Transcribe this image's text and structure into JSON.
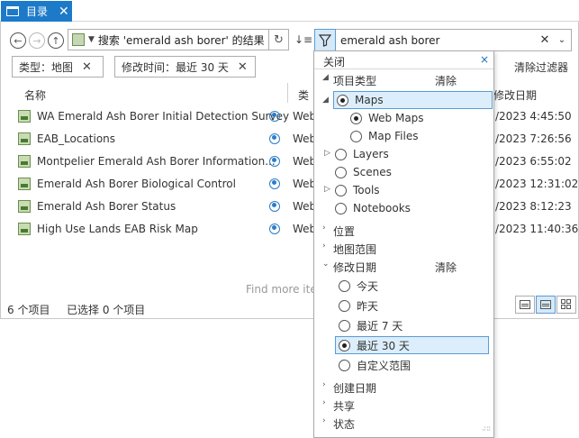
{
  "tab": {
    "label": "目录",
    "close": "✕"
  },
  "nav": {
    "path": "搜索 'emerald ash borer' 的结果",
    "search_value": "emerald ash borer"
  },
  "chips": [
    {
      "label": "类型：地图"
    },
    {
      "label": "修改时间：最近 30 天"
    }
  ],
  "clear_filters": "清除过滤器",
  "columns": {
    "name": "名称",
    "type": "类",
    "date": "修改日期"
  },
  "items": [
    {
      "name": "WA Emerald Ash Borer Initial Detection Survey",
      "type": "Web",
      "date": "/2023 4:45:50"
    },
    {
      "name": "EAB_Locations",
      "type": "Web",
      "date": "/2023 7:26:56"
    },
    {
      "name": "Montpelier Emerald Ash Borer Information...",
      "type": "Web",
      "date": "/2023 6:55:02"
    },
    {
      "name": "Emerald Ash Borer Biological Control",
      "type": "Web",
      "date": "/2023 12:31:02"
    },
    {
      "name": "Emerald Ash Borer Status",
      "type": "Web",
      "date": "/2023 8:12:23"
    },
    {
      "name": "High Use Lands EAB Risk Map",
      "type": "Web",
      "date": "/2023 11:40:36"
    }
  ],
  "find_more": "Find more item",
  "status": {
    "count": "6 个项目",
    "selected": "已选择 0 个项目"
  },
  "dropdown": {
    "close_label": "关闭",
    "close_x": "×",
    "item_type": {
      "label": "项目类型",
      "clear": "清除"
    },
    "types": {
      "maps": "Maps",
      "web_maps": "Web Maps",
      "map_files": "Map Files",
      "layers": "Layers",
      "scenes": "Scenes",
      "tools": "Tools",
      "notebooks": "Notebooks"
    },
    "location": "位置",
    "map_extent": "地图范围",
    "modified": {
      "label": "修改日期",
      "clear": "清除"
    },
    "dates": {
      "today": "今天",
      "yesterday": "昨天",
      "last7": "最近 7 天",
      "last30": "最近 30 天",
      "custom": "自定义范围"
    },
    "created": "创建日期",
    "sharing": "共享",
    "status": "状态"
  },
  "colors": {
    "accent": "#1c7ac9",
    "highlight": "#dceefb"
  }
}
